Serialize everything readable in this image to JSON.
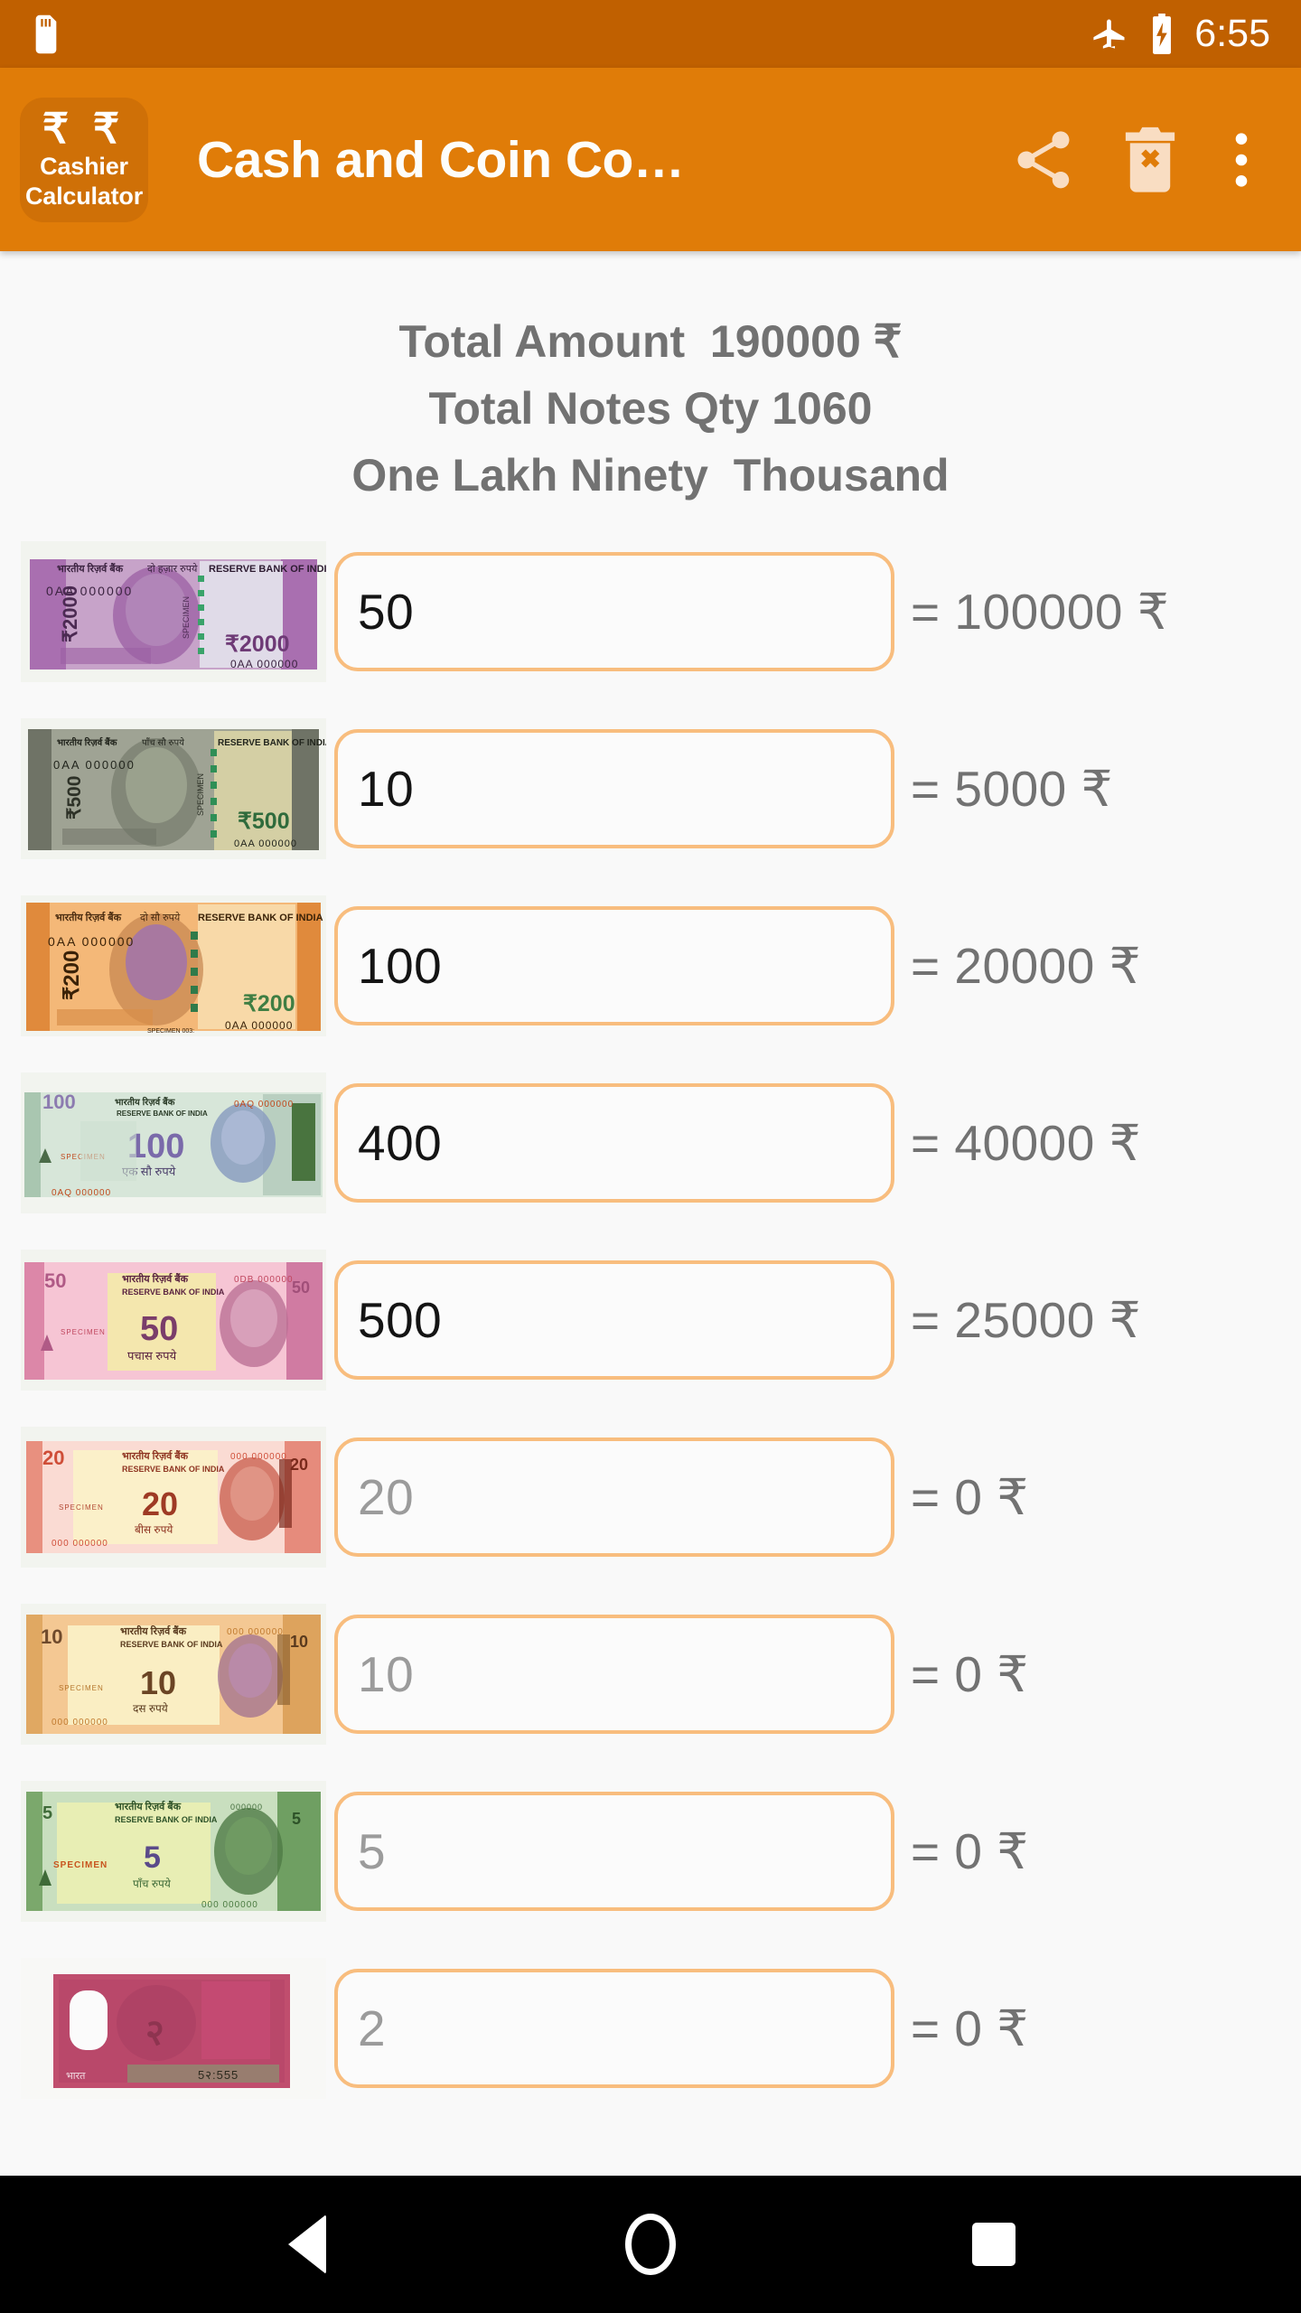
{
  "status_bar": {
    "sim_icon": "sim-card-icon",
    "airplane_icon": "airplane-mode-icon",
    "battery_icon": "battery-charging-icon",
    "time": "6:55",
    "background_color": "#c06000"
  },
  "app_bar": {
    "background_color": "#e07c08",
    "logo": {
      "name": "app-logo",
      "rupee_symbols": "₹ ₹",
      "line1": "Cashier",
      "line2": "Calculator"
    },
    "title": "Cash and Coin Co…",
    "actions": [
      {
        "name": "share-button",
        "icon": "share-icon"
      },
      {
        "name": "clear-all-button",
        "icon": "trash-delete-icon"
      },
      {
        "name": "overflow-menu-button",
        "icon": "three-dots-vertical-icon"
      }
    ]
  },
  "summary": {
    "total_amount_line": "Total Amount  190000 ₹",
    "total_notes_line": "Total Notes Qty 1060",
    "amount_in_words_line": "One Lakh Ninety  Thousand",
    "total_amount": 190000,
    "total_notes_qty": 1060,
    "currency_symbol": "₹"
  },
  "accent_colors": {
    "app_bar": "#e07c08",
    "status_bar": "#c06000",
    "field_border": "#f8bd7e",
    "text_gray": "#727272",
    "value_dark": "#141414",
    "placeholder_gray": "#9b9b9b"
  },
  "rows": [
    {
      "note_name": "note-2000",
      "denomination": 2000,
      "note_label": "₹2000",
      "qty_value": "50",
      "qty_is_placeholder": false,
      "qty_placeholder": "2000",
      "result_label": "= 100000 ₹",
      "result_amount": 100000
    },
    {
      "note_name": "note-500",
      "denomination": 500,
      "note_label": "₹500",
      "qty_value": "10",
      "qty_is_placeholder": false,
      "qty_placeholder": "500",
      "result_label": "= 5000 ₹",
      "result_amount": 5000
    },
    {
      "note_name": "note-200",
      "denomination": 200,
      "note_label": "₹200",
      "qty_value": "100",
      "qty_is_placeholder": false,
      "qty_placeholder": "200",
      "result_label": "= 20000 ₹",
      "result_amount": 20000
    },
    {
      "note_name": "note-100",
      "denomination": 100,
      "note_label": "₹100",
      "qty_value": "400",
      "qty_is_placeholder": false,
      "qty_placeholder": "100",
      "result_label": "= 40000 ₹",
      "result_amount": 40000
    },
    {
      "note_name": "note-50",
      "denomination": 50,
      "note_label": "₹50",
      "qty_value": "500",
      "qty_is_placeholder": false,
      "qty_placeholder": "50",
      "result_label": "= 25000 ₹",
      "result_amount": 25000
    },
    {
      "note_name": "note-20",
      "denomination": 20,
      "note_label": "₹20",
      "qty_value": "20",
      "qty_is_placeholder": true,
      "qty_placeholder": "20",
      "result_label": "= 0 ₹",
      "result_amount": 0
    },
    {
      "note_name": "note-10",
      "denomination": 10,
      "note_label": "₹10",
      "qty_value": "10",
      "qty_is_placeholder": true,
      "qty_placeholder": "10",
      "result_label": "= 0 ₹",
      "result_amount": 0
    },
    {
      "note_name": "note-5",
      "denomination": 5,
      "note_label": "₹5",
      "qty_value": "5",
      "qty_is_placeholder": true,
      "qty_placeholder": "5",
      "result_label": "= 0 ₹",
      "result_amount": 0
    },
    {
      "note_name": "note-2",
      "denomination": 2,
      "note_label": "₹2",
      "qty_value": "2",
      "qty_is_placeholder": true,
      "qty_placeholder": "2",
      "result_label": "= 0 ₹",
      "result_amount": 0
    }
  ],
  "nav_bar": {
    "back": "back-nav-button",
    "home": "home-nav-button",
    "recents": "recents-nav-button"
  }
}
